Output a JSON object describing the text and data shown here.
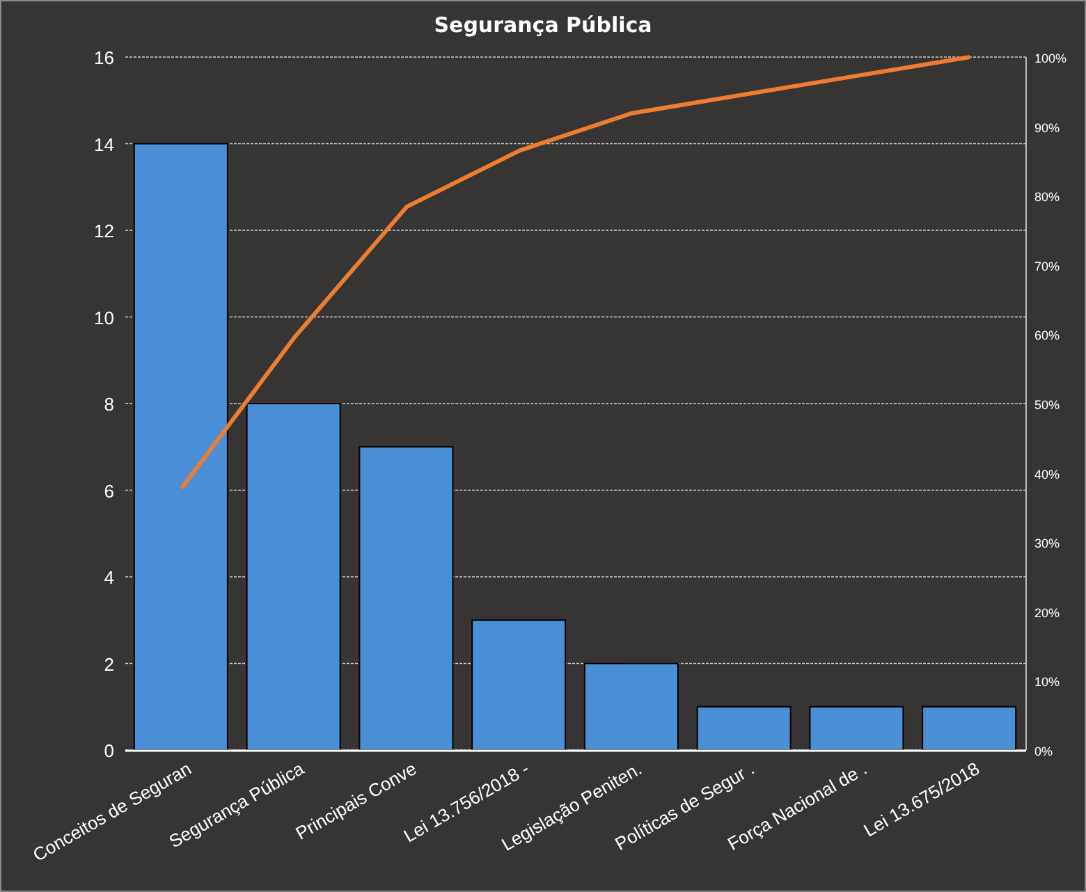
{
  "chart": {
    "chart_data": {
      "type": "bar",
      "title": "Segurança Pública",
      "categories": [
        "Conceitos de Seguran",
        "Segurança Pública",
        "Principais Conve",
        "Lei 13.756/2018 -",
        "Legislação Peniten.",
        "Políticas de Segur .",
        "Força Nacional de .",
        "Lei 13.675/2018"
      ],
      "series": [
        {
          "color": "#4a8fd6",
          "values": [
            14,
            8,
            7,
            3,
            2,
            1,
            1,
            1
          ]
        },
        {
          "color": "#ed7d31",
          "type": "line",
          "axis": "y2",
          "values": [
            37.8,
            59.5,
            78.4,
            86.5,
            91.9,
            94.6,
            97.3,
            100
          ]
        }
      ],
      "grid": true,
      "ylim": [
        0,
        16
      ],
      "yticks": [
        0,
        2,
        4,
        6,
        8,
        10,
        12,
        14,
        16
      ],
      "y2lim": [
        0,
        100
      ],
      "y2ticks": [
        {
          "value": 0,
          "label": "0%"
        },
        {
          "value": 10,
          "label": "10%"
        },
        {
          "value": 20,
          "label": "20%"
        },
        {
          "value": 30,
          "label": "30%"
        },
        {
          "value": 40,
          "label": "40%"
        },
        {
          "value": 50,
          "label": "50%"
        },
        {
          "value": 60,
          "label": "60%"
        },
        {
          "value": 70,
          "label": "70%"
        },
        {
          "value": 80,
          "label": "80%"
        },
        {
          "value": 90,
          "label": "90%"
        },
        {
          "value": 100,
          "label": "100%"
        }
      ]
    }
  }
}
